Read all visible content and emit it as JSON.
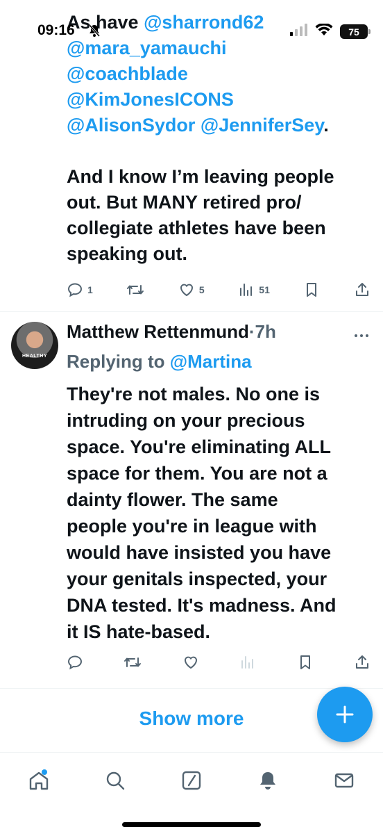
{
  "status_bar": {
    "time": "09:16",
    "battery": "75"
  },
  "top_tweet": {
    "line1_prefix": "As have ",
    "line1_mention": "@sharrond62",
    "mentions": [
      "@mara_yamauchi",
      "@coachblade",
      "@KimJonesICONS"
    ],
    "last_mention_a": "@AlisonSydor",
    "last_mention_b": "@JenniferSey",
    "period": ".",
    "para2_lines": [
      "And I know I’m leaving people",
      "out. But MANY retired pro/",
      "collegiate athletes have been",
      "speaking out."
    ],
    "replies": "1",
    "likes": "5",
    "views": "51"
  },
  "reply_tweet": {
    "author": "Matthew Rettenmund",
    "separator_time": "·7h",
    "replying_to_label": "Replying to ",
    "replying_to_handle": "@Martina",
    "avatar_shirt_text": "HEALTHY",
    "body_lines": [
      "They're not males. No one is",
      "intruding on your precious",
      "space. You're eliminating ALL",
      "space for them. You are not a",
      "dainty flower. The same",
      "people you're in league with",
      "would have insisted you have",
      "your genitals inspected, your",
      "DNA tested. It's madness. And",
      "it IS hate-based."
    ]
  },
  "show_more": "Show more",
  "nav": {
    "items": [
      "home-icon",
      "search-icon",
      "grok-icon",
      "notifications-icon",
      "messages-icon"
    ]
  },
  "colors": {
    "accent": "#1d9bf0",
    "muted": "#536471",
    "text": "#0f1419"
  }
}
